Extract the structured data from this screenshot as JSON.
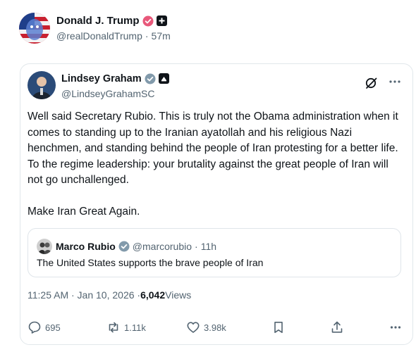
{
  "post": {
    "author_name": "Donald J. Trump",
    "author_handle": "@realDonaldTrump",
    "separator": "·",
    "time_ago": "57m"
  },
  "repost": {
    "author_name": "Lindsey Graham",
    "author_handle": "@LindseyGrahamSC",
    "paragraphs": [
      "Well said Secretary Rubio. This is truly not the Obama administration when it comes to standing up to the Iranian ayatollah and his religious Nazi henchmen, and standing behind the people of Iran protesting for a better life. To the regime leadership: your brutality against the great people of Iran will not go unchallenged.",
      "Make Iran Great Again."
    ],
    "quoted": {
      "author_name": "Marco Rubio",
      "author_handle": "@marcorubio",
      "separator": "·",
      "time_ago": "11h",
      "text": "The United States supports the brave people of Iran"
    },
    "timestamp": "11:25 AM · Jan 10, 2026 · ",
    "views_count": "6,042",
    "views_label": " Views",
    "actions": {
      "replies": "695",
      "reposts": "1.11k",
      "likes": "3.98k"
    }
  },
  "icons": {
    "verified": "verified-badge-icon",
    "affiliation": "square-affiliation-icon",
    "grok": "grok-icon",
    "more": "more-icon",
    "reply": "reply-icon",
    "repost": "repost-icon",
    "like": "like-icon",
    "bookmark": "bookmark-icon",
    "share": "share-icon"
  },
  "colors": {
    "text": "#0f1419",
    "secondary": "#536471",
    "verified_blue": "#829aab",
    "verified_pink": "#e8587a",
    "border": "#e1e7eb"
  }
}
